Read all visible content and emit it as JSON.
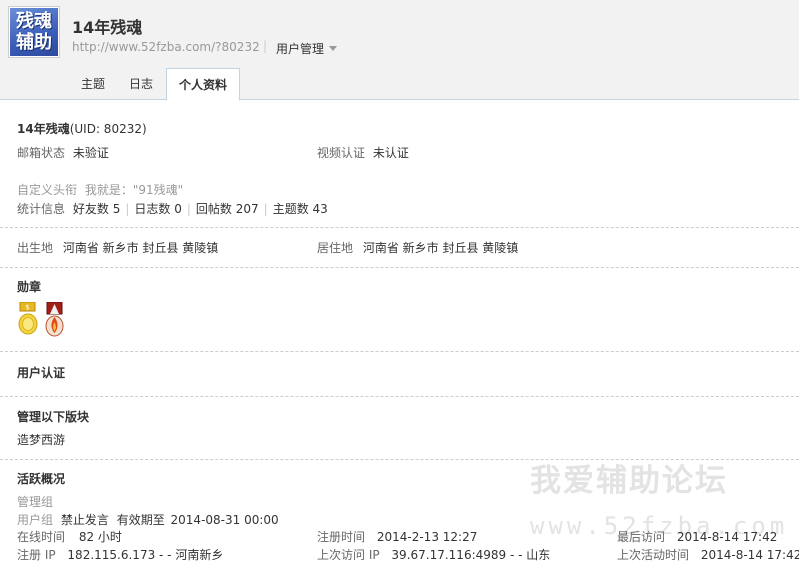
{
  "header": {
    "avatar_text": [
      "残魂",
      "辅助"
    ],
    "username": "14年残魂",
    "home_url": "http://www.52fzba.com/?80232",
    "user_manage_label": "用户管理"
  },
  "tabs": [
    {
      "label": "主题"
    },
    {
      "label": "日志"
    },
    {
      "label": "个人资料",
      "active": true
    }
  ],
  "profile": {
    "name": "14年残魂",
    "uid": "(UID: 80232)",
    "email_label": "邮箱状态",
    "email_value": "未验证",
    "video_label": "视频认证",
    "video_value": "未认证",
    "custom_title_label": "自定义头衔",
    "custom_title_value": "我就是：\"91残魂\"",
    "stats_label": "统计信息",
    "stats": [
      {
        "label": "好友数",
        "value": "5"
      },
      {
        "label": "日志数",
        "value": "0"
      },
      {
        "label": "回帖数",
        "value": "207"
      },
      {
        "label": "主题数",
        "value": "43"
      }
    ],
    "birthplace_label": "出生地",
    "birthplace_value": "河南省 新乡市 封丘县 黄陵镇",
    "residence_label": "居住地",
    "residence_value": "河南省 新乡市 封丘县 黄陵镇"
  },
  "medals": {
    "heading": "勋章",
    "items": [
      "gold-medal-icon",
      "flame-medal-icon"
    ]
  },
  "verification": {
    "heading": "用户认证"
  },
  "moderation": {
    "heading": "管理以下版块",
    "forum": "造梦西游"
  },
  "activity": {
    "heading": "活跃概况",
    "admin_group_label": "管理组",
    "user_group_label": "用户组",
    "user_group_value": "禁止发言",
    "expiry_label": "有效期至",
    "expiry_value": "2014-08-31 00:00",
    "online_label": "在线时间",
    "online_value": "82 小时",
    "register_time_label": "注册时间",
    "register_time_value": "2014-2-13 12:27",
    "last_visit_label": "最后访问",
    "last_visit_value": "2014-8-14 17:42",
    "register_ip_label": "注册 IP",
    "register_ip_value": "182.115.6.173 - - 河南新乡",
    "last_ip_label": "上次访问 IP",
    "last_ip_value": "39.67.17.116:4989 - - 山东",
    "last_active_label": "上次活动时间",
    "last_active_value": "2014-8-14 17:42"
  },
  "watermark": {
    "title": "我爱辅助论坛",
    "url": "www.52fzba.com"
  },
  "colors": {
    "border": "#c2d5e3",
    "header_bg": "#f2f2f2",
    "muted": "#999999"
  }
}
